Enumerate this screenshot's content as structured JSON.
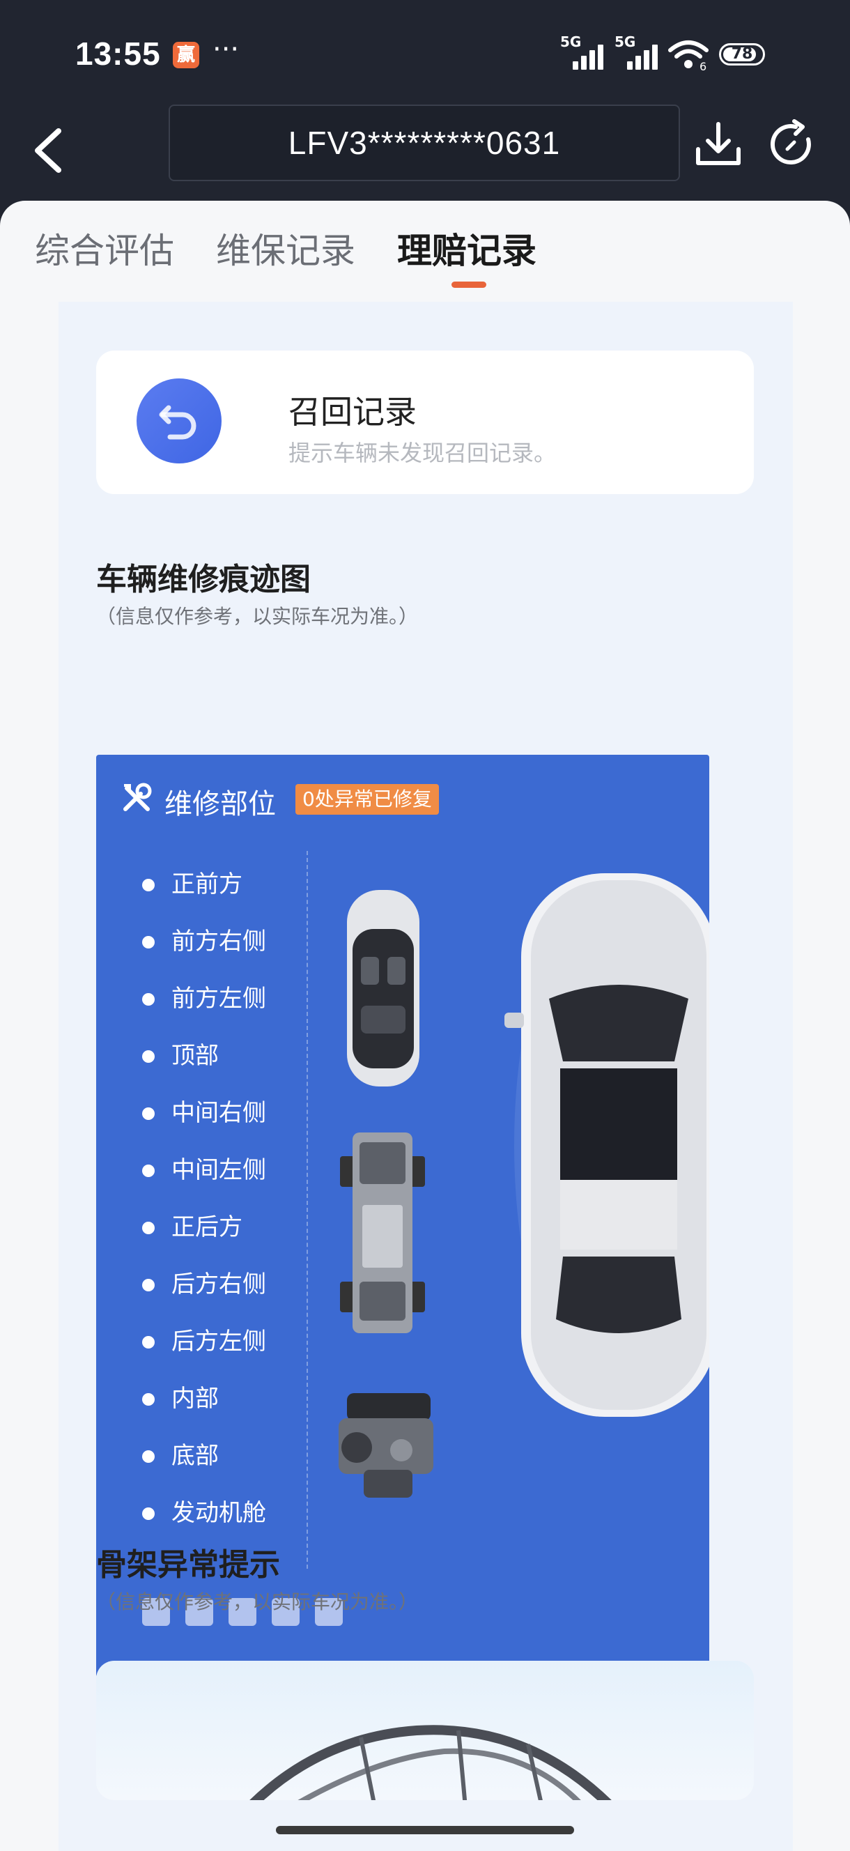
{
  "status_bar": {
    "time": "13:55",
    "app_badge": "赢",
    "more": "···",
    "signal1": "5G",
    "signal2": "5G",
    "wifi_level": "6",
    "battery": "78"
  },
  "header": {
    "vin": "LFV3*********0631"
  },
  "tabs": [
    {
      "label": "综合评估"
    },
    {
      "label": "维保记录"
    },
    {
      "label": "理赔记录"
    }
  ],
  "recall": {
    "title": "召回记录",
    "subtitle": "提示车辆未发现召回记录。"
  },
  "repair_map": {
    "title": "车辆维修痕迹图",
    "note": "（信息仅作参考，以实际车况为准。）",
    "panel_title": "维修部位",
    "badge": "0处异常已修复",
    "parts": [
      {
        "label": "正前方"
      },
      {
        "label": "前方右侧"
      },
      {
        "label": "前方左侧"
      },
      {
        "label": "顶部"
      },
      {
        "label": "中间右侧"
      },
      {
        "label": "中间左侧"
      },
      {
        "label": "正后方"
      },
      {
        "label": "后方右侧"
      },
      {
        "label": "后方左侧"
      },
      {
        "label": "内部"
      },
      {
        "label": "底部"
      },
      {
        "label": "发动机舱"
      }
    ]
  },
  "frame": {
    "title": "骨架异常提示",
    "note": "（信息仅作参考，以实际车况为准。）"
  },
  "colors": {
    "accent": "#e8643a",
    "panel_blue": "#3c6ad2",
    "badge_orange": "#f08c45"
  }
}
